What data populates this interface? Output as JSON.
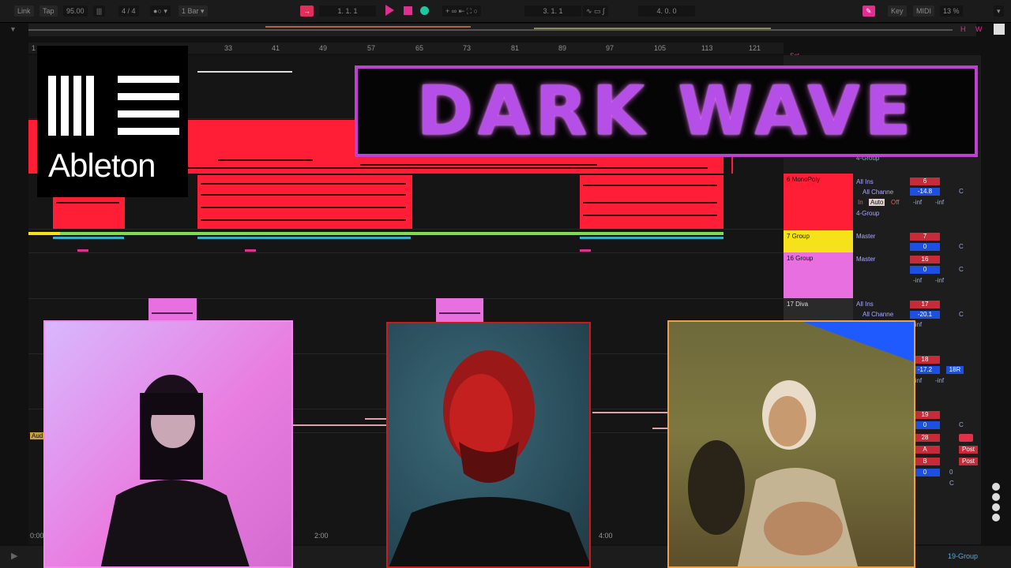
{
  "toolbar": {
    "link": "Link",
    "tap": "Tap",
    "tempo": "95.00",
    "time_signature": "4 / 4",
    "quantize": "1 Bar",
    "position": "1.  1.  1",
    "loop_start": "3.  1.  1",
    "loop_length": "4.  0.  0",
    "key": "Key",
    "midi": "MIDI",
    "cpu": "13 %",
    "accent": "#e02f8f"
  },
  "overview": {
    "h": "H",
    "w": "W"
  },
  "ruler": {
    "bars": [
      "1",
      "33",
      "41",
      "49",
      "57",
      "65",
      "73",
      "81",
      "89",
      "97",
      "105",
      "113",
      "121"
    ],
    "set_label": "Set"
  },
  "timeline": {
    "t0": "0:00",
    "t1": "2:00",
    "t2": "4:00",
    "audio_label": "Aud"
  },
  "tracks": [
    {
      "name": "6 MonoPoly",
      "input": "All Ins",
      "channel": "All Channe",
      "monitor": [
        "In",
        "Auto",
        "Off"
      ],
      "output": "4-Group",
      "number": "6",
      "volume": "-14.8",
      "pan": "C",
      "peak_l": "-inf",
      "peak_r": "-inf",
      "color": "#ff1e35"
    },
    {
      "name": "7 Group",
      "output": "Master",
      "number": "7",
      "volume": "0",
      "pan": "C",
      "color": "#f5e21a"
    },
    {
      "name": "16 Group",
      "output": "Master",
      "number": "16",
      "volume": "0",
      "pan": "C",
      "peak_l": "-inf",
      "peak_r": "-inf",
      "color": "#e76fe0"
    },
    {
      "name": "17 Diva",
      "input": "All Ins",
      "channel": "All Channe",
      "number": "17",
      "volume": "-20.1",
      "pan": "C",
      "peak_l": "-inf",
      "color": "#e76fe0"
    },
    {
      "number": "18",
      "volume": "-17.2",
      "pan": "18R",
      "peak_l": "-inf",
      "peak_r": "-inf"
    },
    {
      "number": "19",
      "volume": "0",
      "pan": "C"
    },
    {
      "number": "28"
    },
    {
      "number": "A",
      "send": "Post"
    },
    {
      "number": "B",
      "send": "Post"
    },
    {
      "volume": "0",
      "pan": "0",
      "extra": "C"
    }
  ],
  "top_output": "4-Group",
  "bottom_right": "19-Group",
  "overlay": {
    "logo_text": "Ableton",
    "title": "DARK WAVE"
  },
  "icons": [
    "play-icon",
    "stop-icon",
    "record-icon",
    "pencil-icon",
    "ableton-logo-icon"
  ]
}
